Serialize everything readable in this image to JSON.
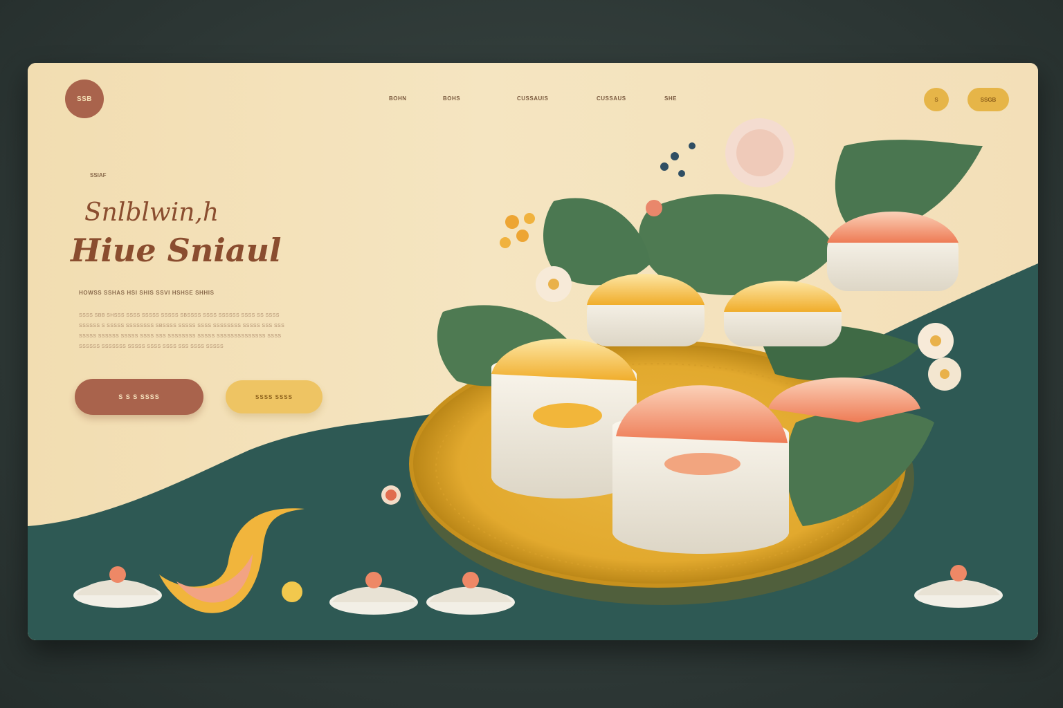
{
  "header": {
    "logo_text": "SSB",
    "nav": [
      "BOHN",
      "BOHS",
      "CUSSAUIS",
      "CUSSAUS",
      "SHE"
    ],
    "icon_button_label": "S",
    "cta_pill_label": "SSGB"
  },
  "hero": {
    "eyebrow": "SSIAF",
    "title_line1": "Snlblwin,h",
    "title_line2": "Hiue Sniaul",
    "subhead": "HOWSS SSHAS HSI SHIS SSVI HSHSE SHHIS",
    "body_lines": [
      "SSSS SBB SHSSS SSSS SSSSS SSSSS SBSSSS SSSS SSSSSS SSSS SS SSSS",
      "SSSSSS S SSSSS SSSSSSSS SBSSSS SSSSS SSSS SSSSSSSS SSSSS SSS SSS",
      "SSSSS SSSSSS SSSSS SSSS SSS SSSSSSSS SSSSS SSSSSSSSSSSSSS SSSS",
      "SSSSSS SSSSSSS SSSSS SSSS SSSS SSS SSSS SSSSS"
    ],
    "primary_button_label": "S  S  S  SSSS",
    "secondary_button_label": "SSSS SSSS"
  },
  "colors": {
    "cream": "#f3dfb5",
    "teal": "#2e5954",
    "terracotta": "#a9634c",
    "mustard": "#e6b548",
    "leaf": "#4e7a52"
  }
}
